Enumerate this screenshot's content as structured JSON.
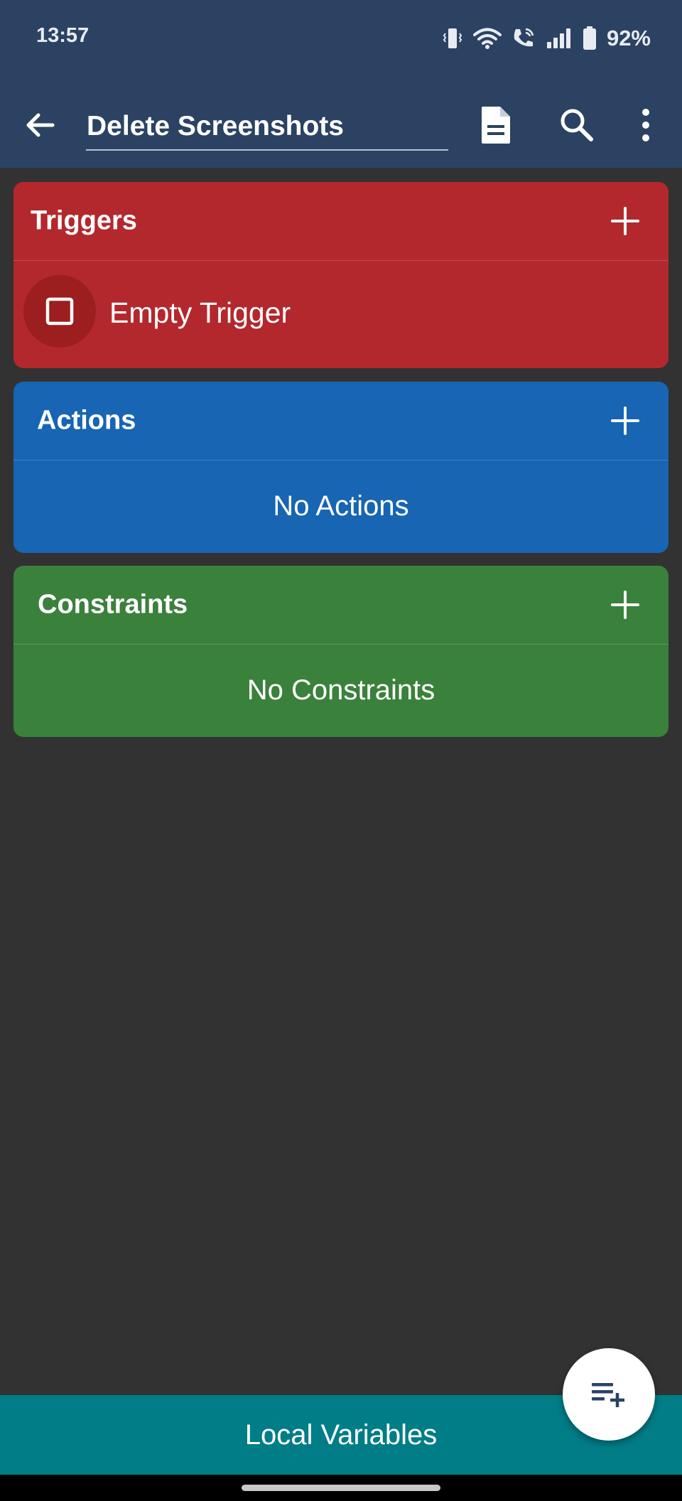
{
  "status_bar": {
    "time": "13:57",
    "battery": "92%",
    "icons": [
      "vibrate-icon",
      "wifi-icon",
      "wifi-call-icon",
      "signal-icon",
      "battery-icon"
    ]
  },
  "app_bar": {
    "title": "Delete Screenshots",
    "icons": [
      "back-arrow-icon",
      "document-icon",
      "search-icon",
      "more-vert-icon"
    ]
  },
  "triggers": {
    "label": "Triggers",
    "items": [
      {
        "label": "Empty Trigger",
        "icon": "checkbox-outline-icon"
      }
    ]
  },
  "actions": {
    "label": "Actions",
    "empty_text": "No Actions"
  },
  "constraints": {
    "label": "Constraints",
    "empty_text": "No Constraints"
  },
  "bottom_bar": {
    "label": "Local Variables"
  },
  "fab": {
    "icon": "playlist-add-icon"
  },
  "colors": {
    "app_bar": "#2c4262",
    "background": "#323232",
    "triggers": "#b3282d",
    "actions": "#1765b3",
    "constraints": "#3a813c",
    "bottom_bar": "#007d87"
  }
}
